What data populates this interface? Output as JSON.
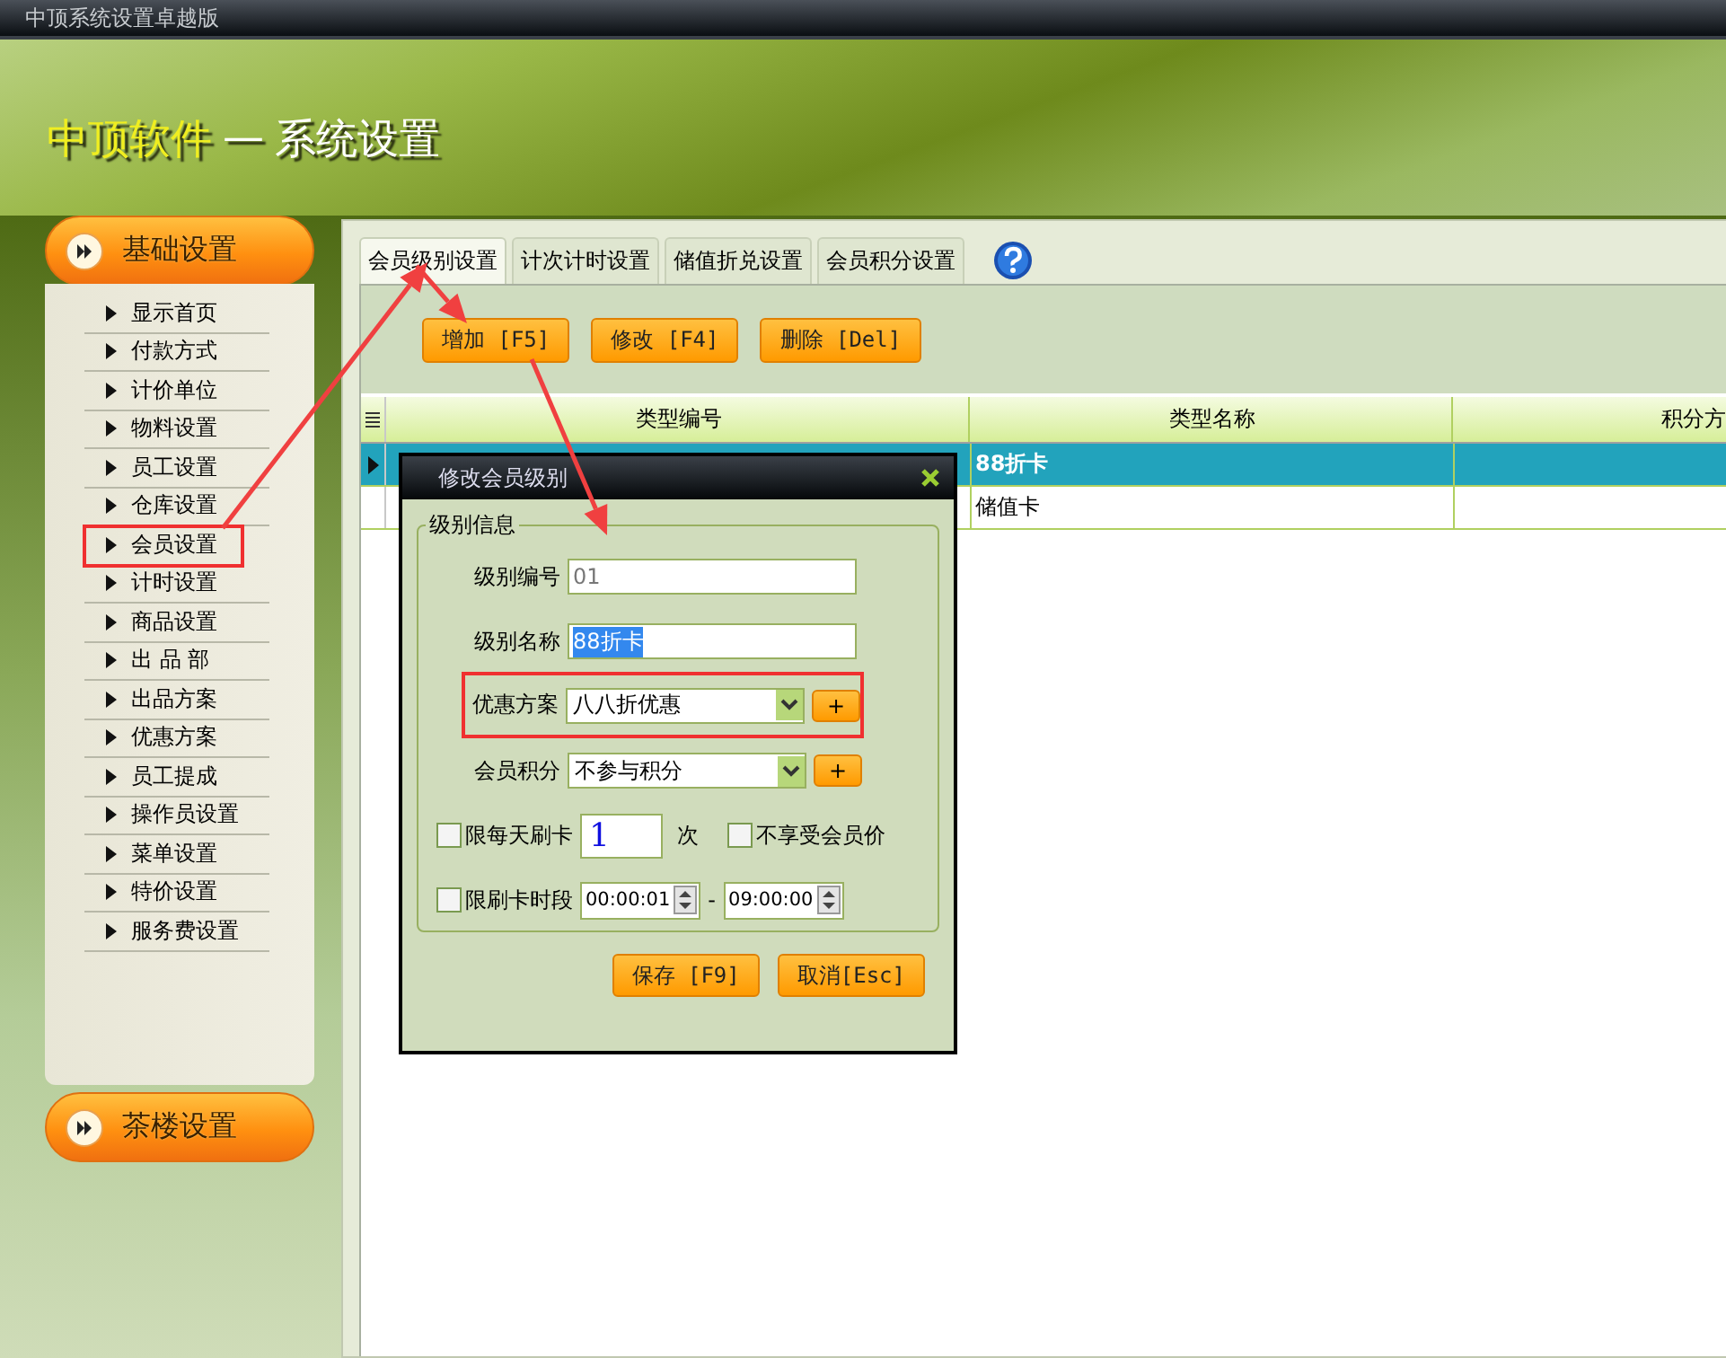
{
  "window": {
    "title": "中顶系统设置卓越版"
  },
  "header": {
    "brand": "中顶软件",
    "separator": "—",
    "section": "系统设置"
  },
  "sidebar": {
    "groups": [
      {
        "label": "基础设置",
        "expanded": true,
        "items": [
          {
            "label": "显示首页",
            "highlighted": false
          },
          {
            "label": "付款方式",
            "highlighted": false
          },
          {
            "label": "计价单位",
            "highlighted": false
          },
          {
            "label": "物料设置",
            "highlighted": false
          },
          {
            "label": "员工设置",
            "highlighted": false
          },
          {
            "label": "仓库设置",
            "highlighted": false
          },
          {
            "label": "会员设置",
            "highlighted": true
          },
          {
            "label": "计时设置",
            "highlighted": false
          },
          {
            "label": "商品设置",
            "highlighted": false
          },
          {
            "label": "出 品 部",
            "highlighted": false
          },
          {
            "label": "出品方案",
            "highlighted": false
          },
          {
            "label": "优惠方案",
            "highlighted": false
          },
          {
            "label": "员工提成",
            "highlighted": false
          },
          {
            "label": "操作员设置",
            "highlighted": false
          },
          {
            "label": "菜单设置",
            "highlighted": false
          },
          {
            "label": "特价设置",
            "highlighted": false
          },
          {
            "label": "服务费设置",
            "highlighted": false
          }
        ]
      },
      {
        "label": "茶楼设置",
        "expanded": false
      }
    ]
  },
  "tabs": [
    {
      "label": "会员级别设置",
      "selected": true
    },
    {
      "label": "计次计时设置",
      "selected": false
    },
    {
      "label": "储值折兑设置",
      "selected": false
    },
    {
      "label": "会员积分设置",
      "selected": false
    }
  ],
  "toolbar": [
    "增加 [F5]",
    "修改 [F4]",
    "删除 [Del]"
  ],
  "table": {
    "columns": [
      "类型编号",
      "类型名称",
      "积分方"
    ],
    "rows": [
      {
        "type_name": "88折卡",
        "selected": true
      },
      {
        "type_name": "储值卡",
        "selected": false
      }
    ]
  },
  "dialog": {
    "title": "修改会员级别",
    "group": "级别信息",
    "fields": [
      {
        "kind": "text",
        "label": "级别编号",
        "value": "01",
        "readonly": true,
        "text_selected": false
      },
      {
        "kind": "text",
        "label": "级别名称",
        "value": "88折卡",
        "readonly": false,
        "text_selected": true
      },
      {
        "kind": "select",
        "label": "优惠方案",
        "value": "八八折优惠",
        "add": "+",
        "highlighted": true
      },
      {
        "kind": "select",
        "label": "会员积分",
        "value": "不参与积分",
        "add": "+",
        "highlighted": false
      },
      {
        "kind": "count",
        "checkbox": {
          "label": "限每天刷卡",
          "checked": false
        },
        "value": "1",
        "unit": "次",
        "extra": {
          "label": "不享受会员价",
          "checked": false
        }
      },
      {
        "kind": "time_range",
        "checkbox": {
          "label": "限刷卡时段",
          "checked": false
        },
        "from": "00:00:01",
        "separator": "-",
        "to": "09:00:00"
      }
    ],
    "buttons": [
      "保存 [F9]",
      "取消[Esc]"
    ]
  }
}
